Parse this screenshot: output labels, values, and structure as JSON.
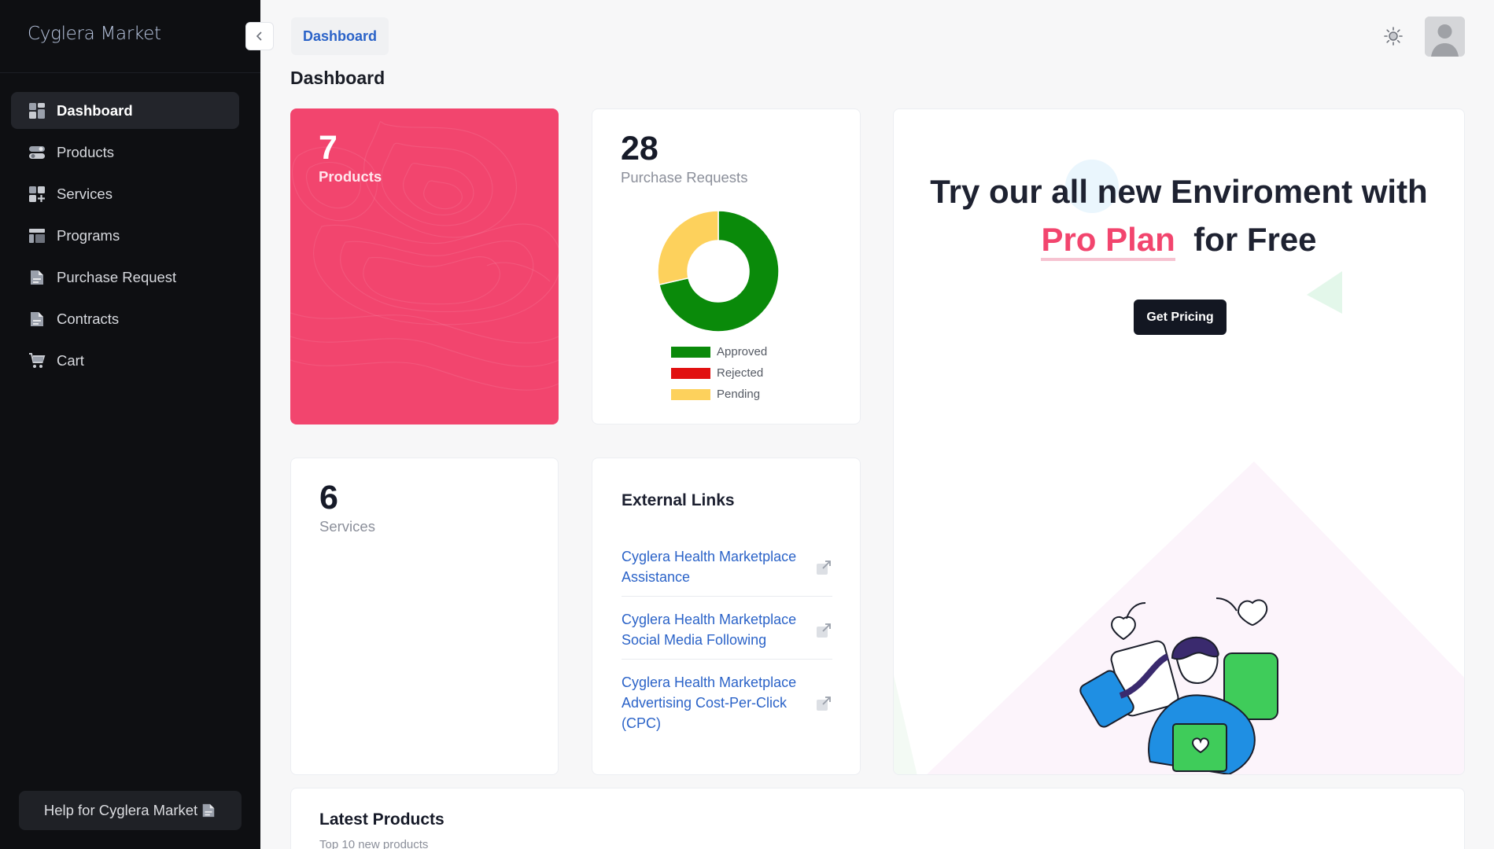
{
  "app": {
    "brand": "Cyglera Market"
  },
  "sidebar": {
    "items": [
      {
        "label": "Dashboard",
        "icon": "dashboard-icon",
        "active": true
      },
      {
        "label": "Products",
        "icon": "products-icon"
      },
      {
        "label": "Services",
        "icon": "services-icon"
      },
      {
        "label": "Programs",
        "icon": "programs-icon"
      },
      {
        "label": "Purchase Request",
        "icon": "document-icon"
      },
      {
        "label": "Contracts",
        "icon": "document-icon"
      },
      {
        "label": "Cart",
        "icon": "cart-icon"
      }
    ],
    "help_label": "Help for Cyglera Market"
  },
  "header": {
    "breadcrumb": "Dashboard",
    "page_title": "Dashboard"
  },
  "stats": {
    "products": {
      "value": "7",
      "label": "Products"
    },
    "purchase_requests": {
      "value": "28",
      "label": "Purchase Requests"
    },
    "services": {
      "value": "6",
      "label": "Services"
    }
  },
  "chart_data": {
    "type": "pie",
    "categories": [
      "Approved",
      "Rejected",
      "Pending"
    ],
    "values": [
      20,
      0,
      8
    ],
    "colors": [
      "#0a8a0a",
      "#e11010",
      "#fdd15c"
    ],
    "donut": true,
    "legend": "bottom"
  },
  "promo": {
    "line1": "Try our all new Enviroment with",
    "accent": "Pro Plan",
    "line2_rest": "for Free",
    "button": "Get Pricing"
  },
  "external_links": {
    "title": "External Links",
    "items": [
      "Cyglera Health Marketplace Assistance",
      "Cyglera Health Marketplace Social Media Following",
      "Cyglera Health Marketplace Advertising Cost-Per-Click (CPC)"
    ]
  },
  "latest": {
    "title": "Latest Products",
    "subtitle": "Top 10 new products"
  },
  "colors": {
    "accent": "#f2456e",
    "link": "#2b63c8",
    "sidebar": "#0e0f12"
  }
}
